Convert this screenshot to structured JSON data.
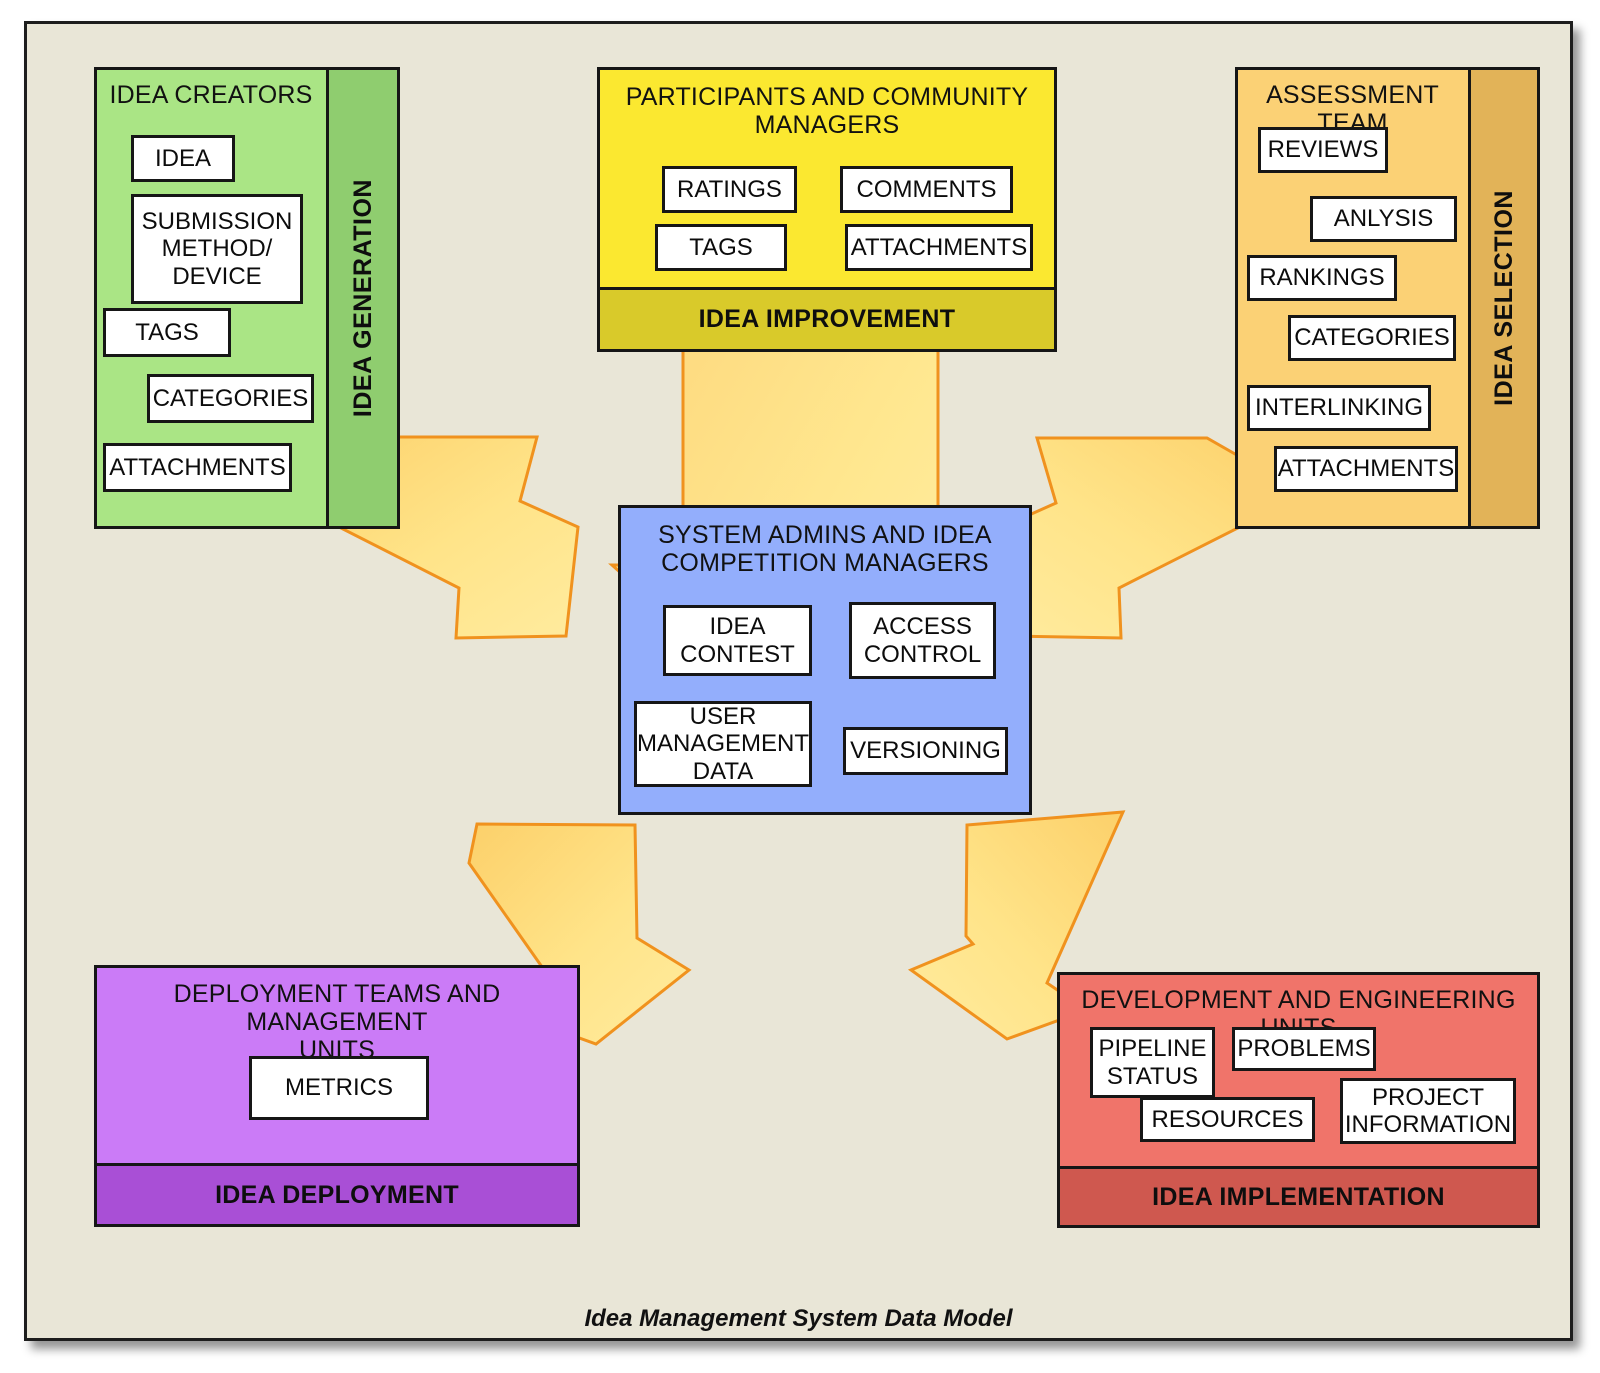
{
  "diagram": {
    "caption": "Idea Management System Data Model",
    "colors": {
      "canvas": "#e9e6d7",
      "green_body": "#aae585",
      "green_strip": "#8fcd6f",
      "yellow_body": "#fbe830",
      "yellow_strip": "#d9ca2a",
      "orange_body": "#fbd175",
      "orange_strip": "#e2b358",
      "blue_body": "#93aefc",
      "purple_body": "#cb7bf7",
      "purple_strip": "#a94fd6",
      "red_body": "#f0746a",
      "red_strip": "#cf584f",
      "arrow_fill": "#ffe17a",
      "arrow_stroke": "#f0921e"
    }
  },
  "boxes": {
    "creators": {
      "title": "IDEA CREATORS",
      "phase": "IDEA GENERATION",
      "items": [
        "IDEA",
        "SUBMISSION\nMETHOD/\nDEVICE",
        "TAGS",
        "CATEGORIES",
        "ATTACHMENTS"
      ]
    },
    "participants": {
      "title": "PARTICIPANTS AND COMMUNITY\nMANAGERS",
      "phase": "IDEA IMPROVEMENT",
      "items": [
        "RATINGS",
        "COMMENTS",
        "TAGS",
        "ATTACHMENTS"
      ]
    },
    "assessment": {
      "title": "ASSESSMENT TEAM",
      "phase": "IDEA SELECTION",
      "items": [
        "REVIEWS",
        "ANLYSIS",
        "RANKINGS",
        "CATEGORIES",
        "INTERLINKING",
        "ATTACHMENTS"
      ]
    },
    "admins": {
      "title": "SYSTEM ADMINS AND IDEA\nCOMPETITION MANAGERS",
      "phase": "",
      "items": [
        "IDEA\nCONTEST",
        "ACCESS\nCONTROL",
        "USER\nMANAGEMENT\nDATA",
        "VERSIONING"
      ]
    },
    "deployment": {
      "title": "DEPLOYMENT TEAMS AND MANAGEMENT\nUNITS",
      "phase": "IDEA DEPLOYMENT",
      "items": [
        "METRICS"
      ]
    },
    "development": {
      "title": "DEVELOPMENT AND ENGINEERING UNITS",
      "phase": "IDEA IMPLEMENTATION",
      "items": [
        "PIPELINE\nSTATUS",
        "PROBLEMS",
        "RESOURCES",
        "PROJECT\nINFORMATION"
      ]
    }
  },
  "arrows": [
    {
      "name": "arrow-participants-to-admins",
      "from": "participants",
      "to": "admins",
      "direction": "down"
    },
    {
      "name": "arrow-creators-to-admins",
      "from": "creators",
      "to": "admins",
      "direction": "down-right"
    },
    {
      "name": "arrow-assessment-to-admins",
      "from": "assessment",
      "to": "admins",
      "direction": "down-left"
    },
    {
      "name": "arrow-deployment-to-admins",
      "from": "deployment",
      "to": "admins",
      "direction": "up-right"
    },
    {
      "name": "arrow-development-to-admins",
      "from": "development",
      "to": "admins",
      "direction": "up-left"
    }
  ]
}
